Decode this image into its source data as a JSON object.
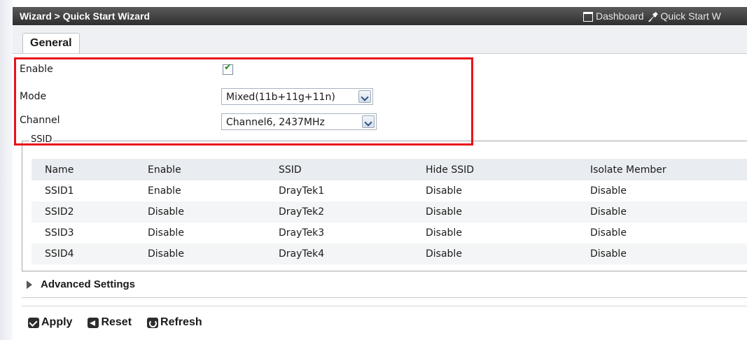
{
  "header": {
    "breadcrumb": "Wizard > Quick Start Wizard",
    "dashboard_label": "Dashboard",
    "quickstart_label": "Quick Start W"
  },
  "tabs": [
    {
      "label": "General",
      "active": true
    }
  ],
  "form": {
    "enable_label": "Enable",
    "enable_checked": true,
    "mode_label": "Mode",
    "mode_value": "Mixed(11b+11g+11n)",
    "channel_label": "Channel",
    "channel_value": "Channel6, 2437MHz"
  },
  "ssid_group": {
    "legend": "SSID",
    "columns": [
      "Name",
      "Enable",
      "SSID",
      "Hide SSID",
      "Isolate Member"
    ],
    "rows": [
      [
        "SSID1",
        "Enable",
        "DrayTek1",
        "Disable",
        "Disable"
      ],
      [
        "SSID2",
        "Disable",
        "DrayTek2",
        "Disable",
        "Disable"
      ],
      [
        "SSID3",
        "Disable",
        "DrayTek3",
        "Disable",
        "Disable"
      ],
      [
        "SSID4",
        "Disable",
        "DrayTek4",
        "Disable",
        "Disable"
      ]
    ]
  },
  "advanced_label": "Advanced Settings",
  "actions": {
    "apply": "Apply",
    "reset": "Reset",
    "refresh": "Refresh"
  },
  "colors": {
    "highlight": "#e8131a",
    "title_bg": "#3a3a3a",
    "check": "#1d8f1d"
  }
}
